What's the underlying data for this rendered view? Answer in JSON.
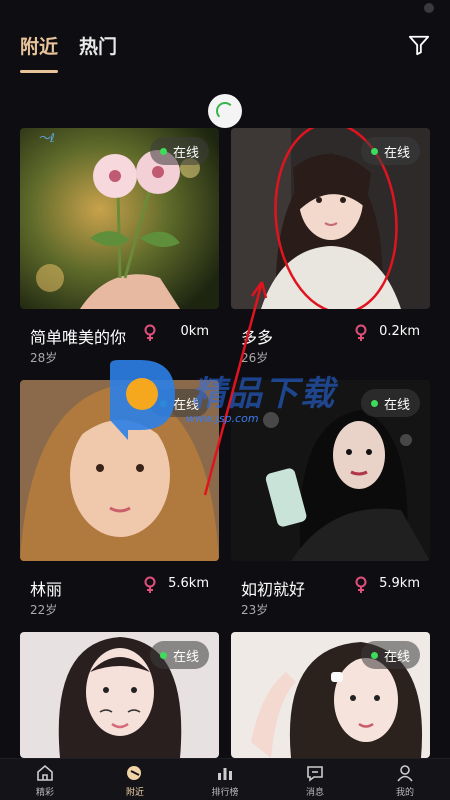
{
  "header": {
    "tabs": [
      {
        "label": "附近",
        "active": true
      },
      {
        "label": "热门",
        "active": false
      }
    ]
  },
  "cards": [
    {
      "name": "简单唯美的你",
      "age": "28岁",
      "distance": "0km",
      "status": "在线",
      "online": true
    },
    {
      "name": "多多",
      "age": "26岁",
      "distance": "0.2km",
      "status": "在线",
      "online": true
    },
    {
      "name": "林丽",
      "age": "22岁",
      "distance": "5.6km",
      "status": "在线",
      "online": true
    },
    {
      "name": "如初就好",
      "age": "23岁",
      "distance": "5.9km",
      "status": "在线",
      "online": true
    },
    {
      "name": "",
      "age": "",
      "distance": "",
      "status": "在线",
      "online": true
    },
    {
      "name": "",
      "age": "",
      "distance": "",
      "status": "在线",
      "online": true
    }
  ],
  "tabbar": {
    "items": [
      {
        "label": "精彩",
        "icon": "home-icon"
      },
      {
        "label": "附近",
        "icon": "nearby-icon",
        "active": true
      },
      {
        "label": "排行榜",
        "icon": "ranking-icon"
      },
      {
        "label": "消息",
        "icon": "message-icon"
      },
      {
        "label": "我的",
        "icon": "profile-icon"
      }
    ]
  },
  "watermark": {
    "text": "精品下载",
    "url": "www.jsp.com"
  },
  "colors": {
    "accent": "#e9c49b",
    "online_dot": "#3ddc5a",
    "female_icon": "#e0507a",
    "background": "#0e0e12"
  }
}
